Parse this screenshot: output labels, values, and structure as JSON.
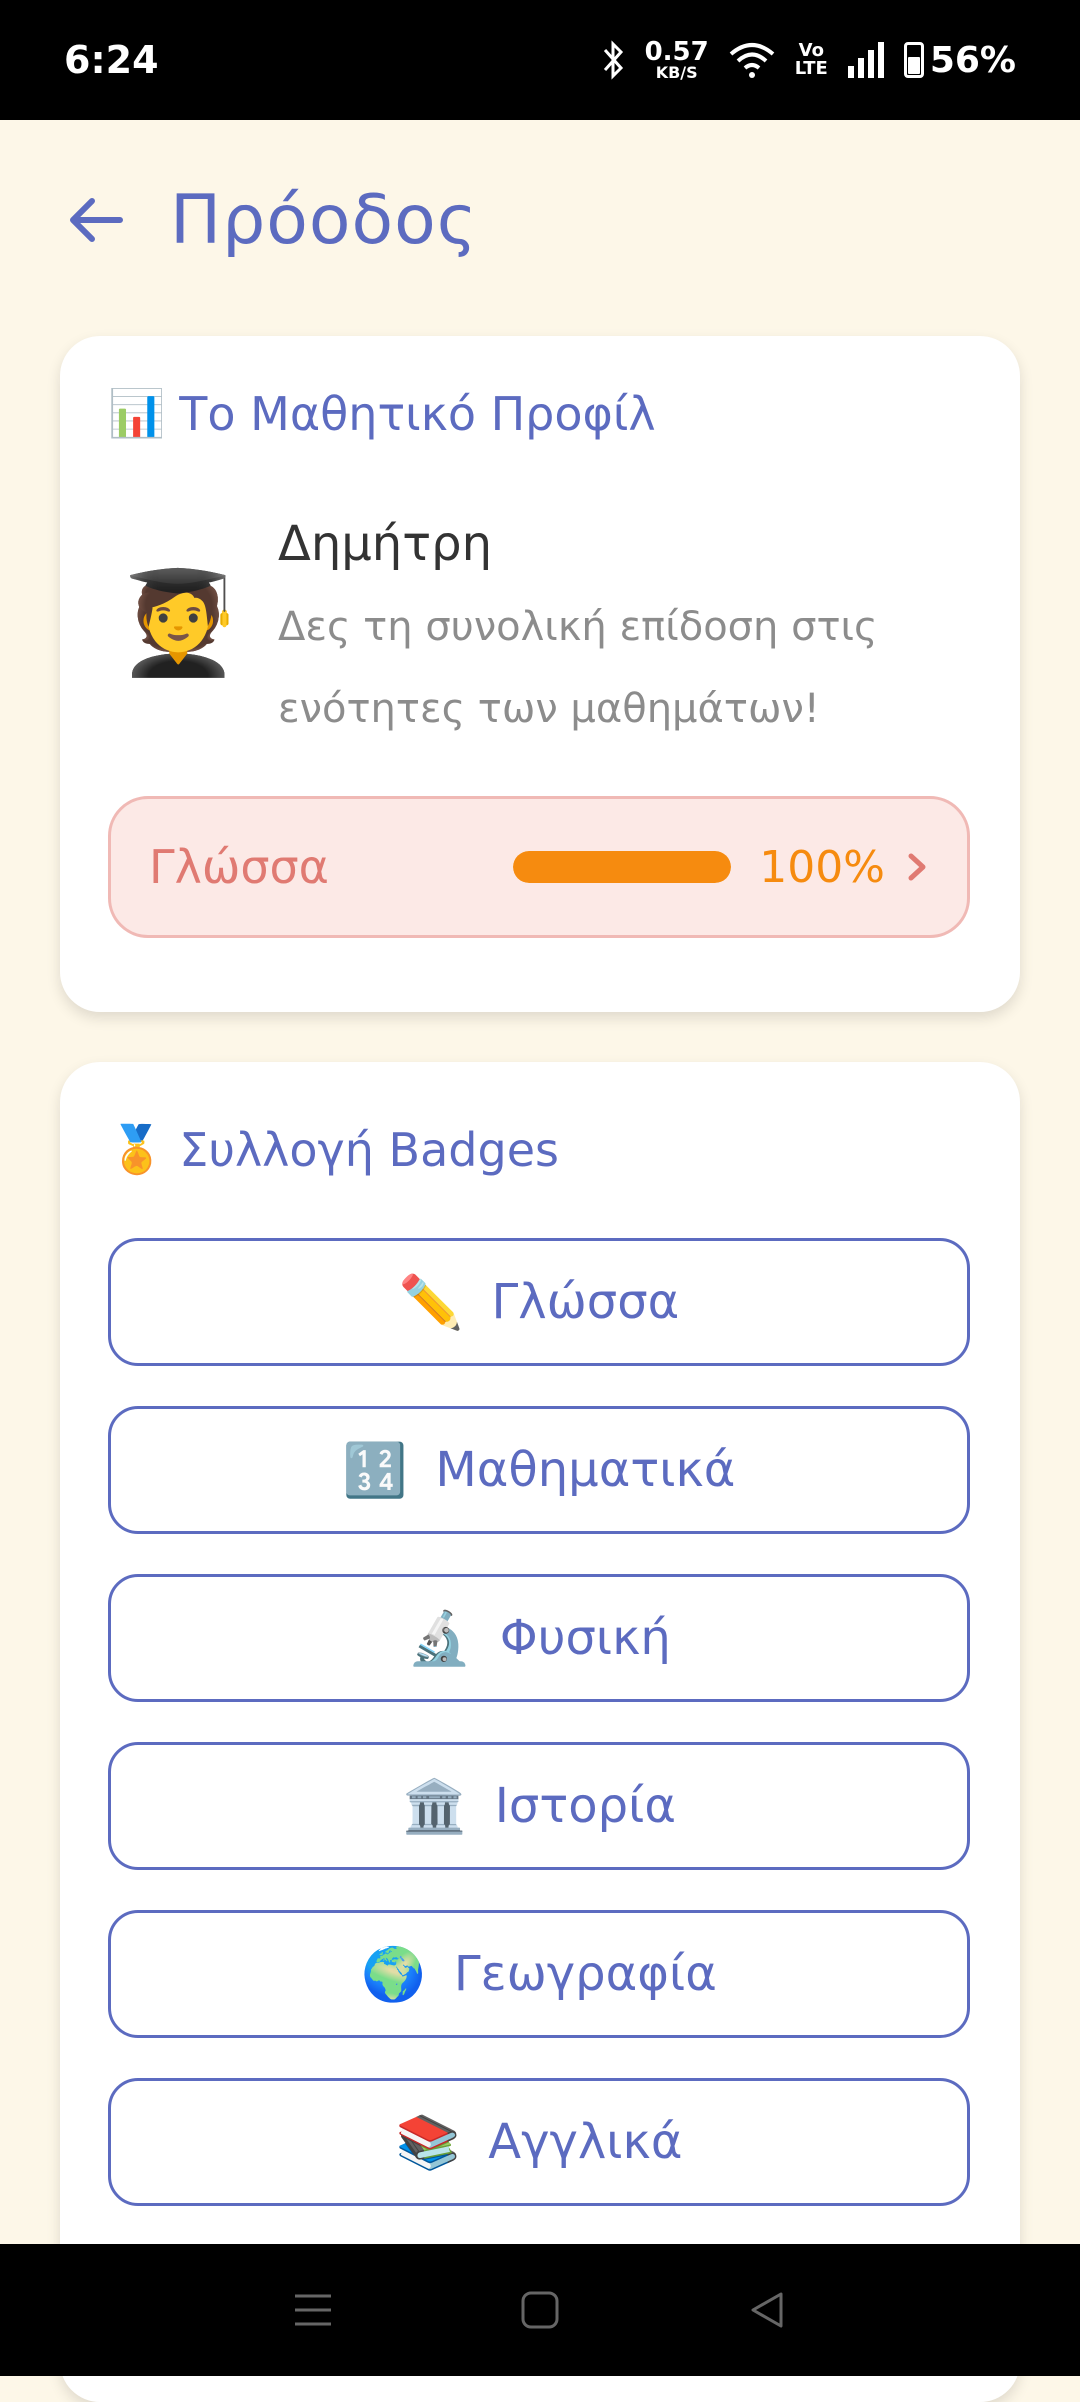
{
  "status_bar": {
    "time": "6:24",
    "net_speed_value": "0.57",
    "net_speed_unit": "KB/S",
    "volte_top": "Vo",
    "volte_bottom": "LTE",
    "battery": "56%",
    "battery_level": 0.56
  },
  "header": {
    "title": "Πρόοδος"
  },
  "profile_card": {
    "title": "Το Μαθητικό Προφίλ",
    "title_emoji": "📊",
    "avatar_emoji": "🧑‍🎓",
    "name": "Δημήτρη",
    "description": "Δες τη συνολική επίδοση στις ενότητες των μαθημάτων!",
    "progress": {
      "subject": "Γλώσσα",
      "percent_label": "100%",
      "value": 1.0,
      "color": "#f68b0f"
    }
  },
  "badges_card": {
    "title": "Συλλογή Badges",
    "title_emoji": "🏅",
    "items": [
      {
        "emoji": "✏️",
        "label": "Γλώσσα"
      },
      {
        "emoji": "🔢",
        "label": "Μαθηματικά"
      },
      {
        "emoji": "🔬",
        "label": "Φυσική"
      },
      {
        "emoji": "🏛️",
        "label": "Ιστορία"
      },
      {
        "emoji": "🌍",
        "label": "Γεωγραφία"
      },
      {
        "emoji": "📚",
        "label": "Αγγλικά"
      }
    ]
  },
  "colors": {
    "accent": "#5c6bc0",
    "background": "#fdf7e8",
    "progress_bg": "#fce9e6",
    "progress_text": "#e07a72"
  },
  "icons": {
    "back": "arrow-left-icon",
    "chevron": "chevron-right-icon",
    "nav_menu": "menu-icon",
    "nav_home": "home-icon",
    "nav_back": "back-triangle-icon"
  }
}
